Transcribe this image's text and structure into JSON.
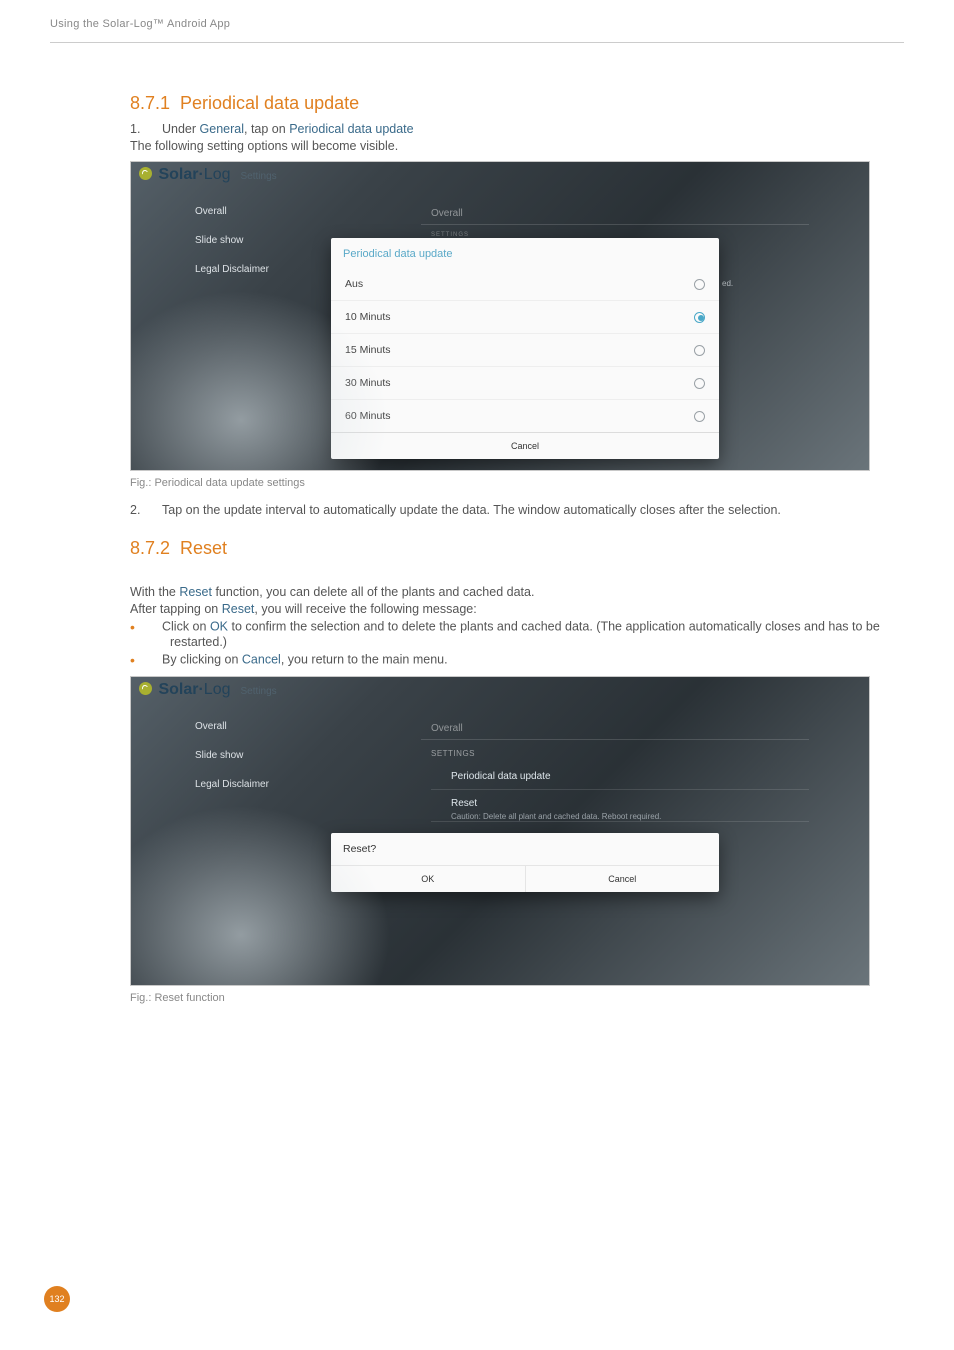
{
  "header": "Using the Solar-Log™ Android App",
  "page_number": "132",
  "section1": {
    "number": "8.7.1",
    "title": "Periodical data update",
    "step1_num": "1.",
    "step1_prefix": "Under ",
    "step1_link1": "General",
    "step1_mid": ", tap on ",
    "step1_link2": "Periodical data update",
    "step1_subtext": "The following setting options will become visible.",
    "caption": "Fig.: Periodical data update settings",
    "step2_num": "2.",
    "step2_text": "Tap on the update interval to automatically update the data. The window automatically closes after the selection."
  },
  "screenshot1": {
    "brand1": "Solar",
    "brand2": "Log",
    "appbar_sub": "Settings",
    "sidebar": {
      "overall": "Overall",
      "slideshow": "Slide show",
      "legal": "Legal Disclaimer"
    },
    "panel_header": "Overall",
    "panel_settings_faint": "SETTINGS",
    "dialog_title": "Periodical data update",
    "options": {
      "aus": "Aus",
      "m10": "10 Minuts",
      "m15": "15 Minuts",
      "m30": "30 Minuts",
      "m60": "60 Minuts"
    },
    "cancel": "Cancel",
    "partial": "ed."
  },
  "section2": {
    "number": "8.7.2",
    "title": "Reset",
    "intro_prefix": "With the ",
    "intro_link": "Reset",
    "intro_suffix": " function, you can delete all of the plants and cached data.",
    "line2_prefix": "After tapping on ",
    "line2_link": "Reset",
    "line2_suffix": ", you will receive the following message:",
    "bullet1_prefix": "Click on ",
    "bullet1_link": "OK",
    "bullet1_suffix": " to confirm the selection and to delete the plants and cached data. (The application automatically closes and has to be restarted.)",
    "bullet2_prefix": "By clicking on ",
    "bullet2_link": "Cancel",
    "bullet2_suffix": ", you return to the main menu.",
    "caption": "Fig.: Reset function"
  },
  "screenshot2": {
    "brand1": "Solar",
    "brand2": "Log",
    "appbar_sub": "Settings",
    "sidebar": {
      "overall": "Overall",
      "slideshow": "Slide show",
      "legal": "Legal Disclaimer"
    },
    "panel_header": "Overall",
    "panel_settings": "SETTINGS",
    "pdu": "Periodical data update",
    "reset_label": "Reset",
    "reset_sub": "Caution: Delete all plant and cached data. Reboot required.",
    "dialog_title": "Reset?",
    "ok": "OK",
    "cancel": "Cancel"
  }
}
